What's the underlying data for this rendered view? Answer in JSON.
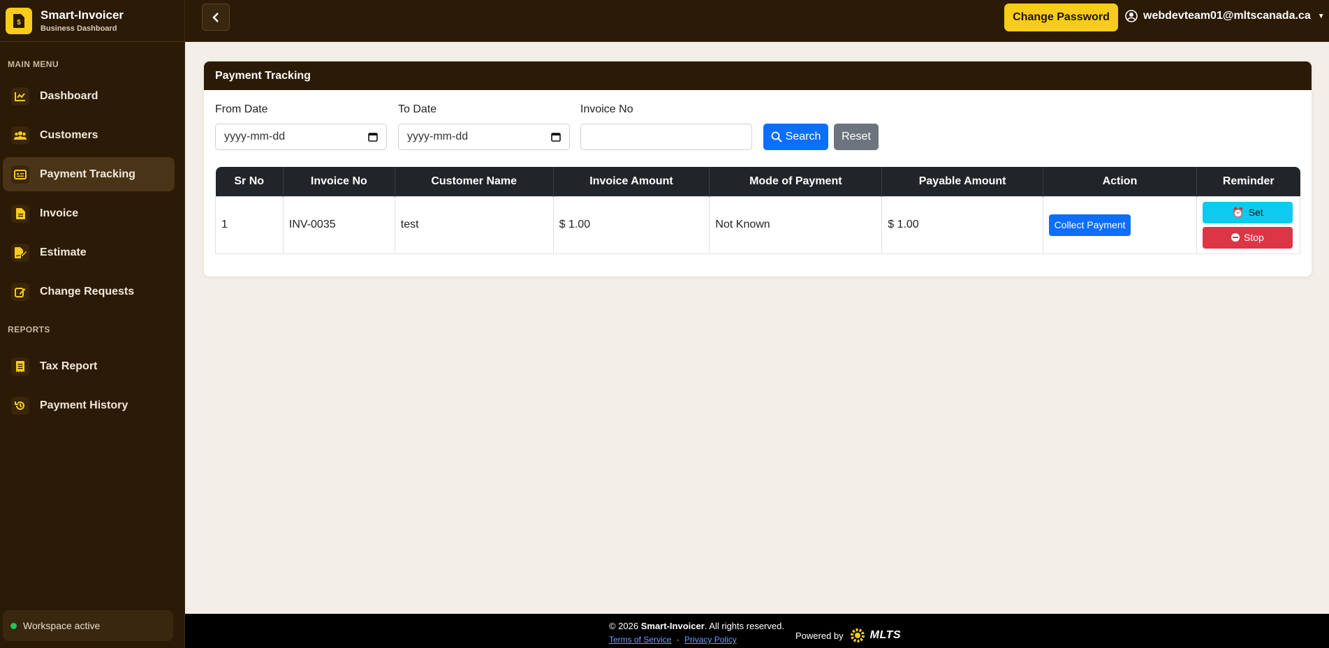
{
  "brand": {
    "name": "Smart-Invoicer",
    "subtitle": "Business Dashboard"
  },
  "sidebar": {
    "main_menu_label": "MAIN MENU",
    "reports_label": "REPORTS",
    "items": [
      {
        "label": "Dashboard",
        "icon": "chart-line-icon"
      },
      {
        "label": "Customers",
        "icon": "users-icon"
      },
      {
        "label": "Payment Tracking",
        "icon": "credit-card-icon",
        "active": true
      },
      {
        "label": "Invoice",
        "icon": "file-invoice-icon"
      },
      {
        "label": "Estimate",
        "icon": "file-signature-icon"
      },
      {
        "label": "Change Requests",
        "icon": "edit-icon"
      }
    ],
    "report_items": [
      {
        "label": "Tax Report",
        "icon": "receipt-icon"
      },
      {
        "label": "Payment History",
        "icon": "history-icon"
      }
    ],
    "workspace_status": "Workspace active"
  },
  "topbar": {
    "change_password": "Change Password",
    "user_email": "webdevteam01@mltscanada.ca"
  },
  "card": {
    "title": "Payment Tracking",
    "filters": {
      "from_label": "From Date",
      "from_placeholder": "yyyy-mm-dd",
      "to_label": "To Date",
      "to_placeholder": "yyyy-mm-dd",
      "invoice_label": "Invoice No",
      "invoice_value": ""
    },
    "search_label": "Search",
    "reset_label": "Reset"
  },
  "table": {
    "headers": [
      "Sr No",
      "Invoice No",
      "Customer Name",
      "Invoice Amount",
      "Mode of Payment",
      "Payable Amount",
      "Action",
      "Reminder"
    ],
    "rows": [
      {
        "sr": "1",
        "invoice": "INV-0035",
        "customer": "test",
        "amount": "$ 1.00",
        "mode": "Not Known",
        "payable": "$ 1.00",
        "action": "Collect Payment",
        "set": "Set",
        "stop": "Stop"
      }
    ]
  },
  "footer": {
    "copyright_prefix": "© 2026",
    "brand": "Smart-Invoicer",
    "copyright_suffix": ". All rights reserved.",
    "terms": "Terms of Service",
    "separator": "·",
    "privacy": "Privacy Policy",
    "powered_by": "Powered by",
    "powered_brand": "MLTS"
  },
  "colors": {
    "sidebar_bg": "#2b1a05",
    "accent": "#f7cc1a",
    "primary": "#0d6efd",
    "info": "#0dcaf0",
    "danger": "#dc3545"
  }
}
